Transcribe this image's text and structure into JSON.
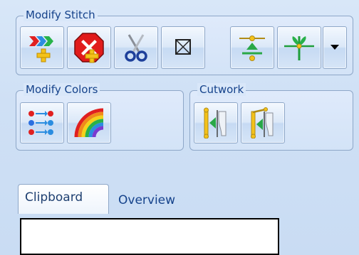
{
  "groups": {
    "modify_stitch": {
      "title": "Modify Stitch"
    },
    "modify_colors": {
      "title": "Modify Colors"
    },
    "cutwork": {
      "title": "Cutwork"
    }
  },
  "tabs": [
    {
      "label": "Clipboard",
      "active": true
    },
    {
      "label": "Overview",
      "active": false
    }
  ],
  "icons": {
    "modify_stitch": [
      "insert-stitch-icon",
      "delete-stitch-icon",
      "cut-stitch-icon",
      "stitch-box-icon",
      "stitch-align-icon",
      "stitch-plant-icon",
      "dropdown-arrow-icon"
    ],
    "modify_colors": [
      "reorder-colors-icon",
      "rainbow-icon"
    ],
    "cutwork": [
      "cutwork-needle-left-icon",
      "cutwork-needle-right-icon"
    ]
  },
  "colors": {
    "panel_bg": "#cfe0f5",
    "group_border": "#8ea7c8",
    "title_text": "#15428b"
  }
}
